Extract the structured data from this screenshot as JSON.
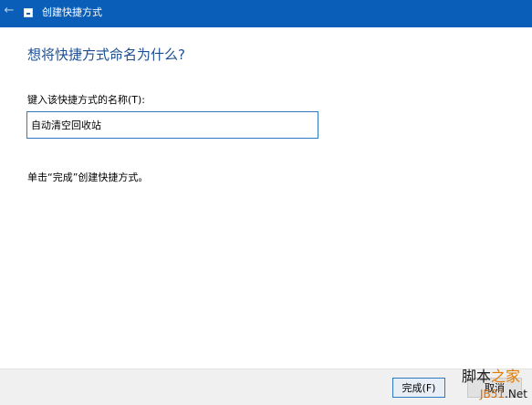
{
  "window": {
    "title": "创建快捷方式",
    "back_icon": "back-arrow-icon",
    "app_icon": "shortcut-icon"
  },
  "main": {
    "heading": "想将快捷方式命名为什么?",
    "name_label": "键入该快捷方式的名称(T):",
    "name_value": "自动清空回收站",
    "hint": "单击“完成”创建快捷方式。"
  },
  "footer": {
    "finish_label": "完成(F)",
    "cancel_label": "取消"
  },
  "watermark": {
    "brand": "脚本",
    "brand_accent": "之家",
    "site": "JB51",
    "site_accent": ".Net"
  },
  "colors": {
    "titlebar": "#0a5eb8",
    "heading": "#1c4e93",
    "input_border": "#2f78c4",
    "footer": "#f0f0f0"
  }
}
